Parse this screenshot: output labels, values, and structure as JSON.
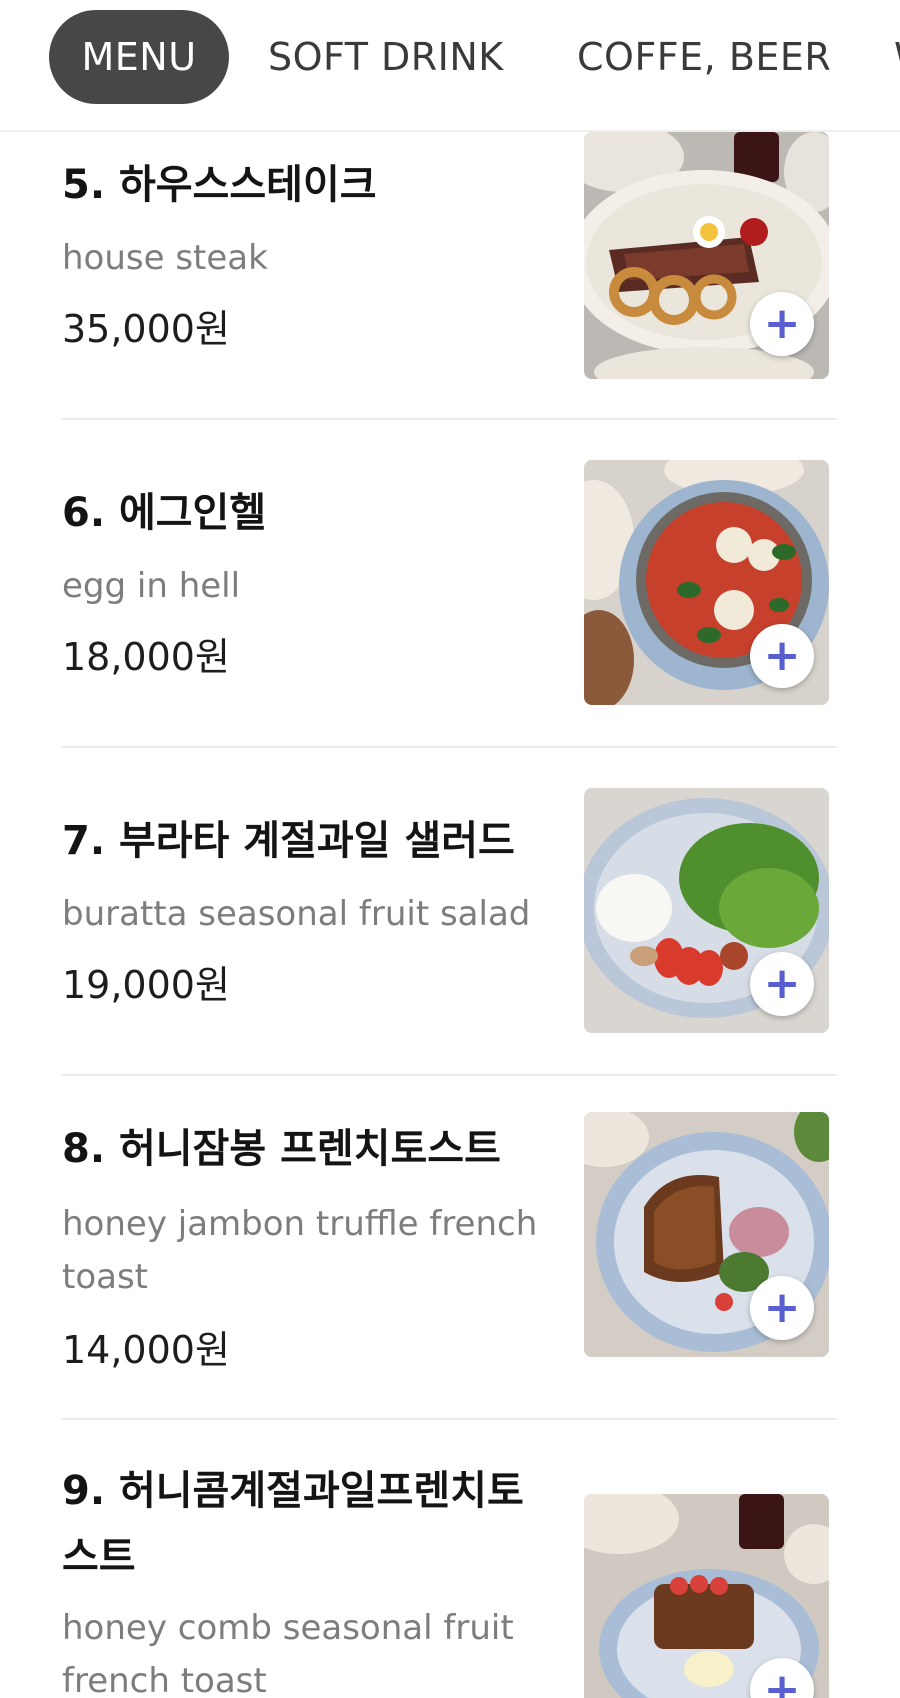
{
  "tabs": [
    {
      "label": "MENU",
      "active": true
    },
    {
      "label": "SOFT DRINK",
      "active": false
    },
    {
      "label": "COFFE, BEER",
      "active": false
    },
    {
      "label": "W",
      "active": false
    }
  ],
  "items": [
    {
      "name": "5. 하우스스테이크",
      "desc": "house steak",
      "price": "35,000원"
    },
    {
      "name": "6. 에그인헬",
      "desc": "egg in hell",
      "price": "18,000원"
    },
    {
      "name": "7. 부라타 계절과일 샐러드",
      "desc": "buratta seasonal fruit salad",
      "price": "19,000원"
    },
    {
      "name": "8. 허니잠봉 프렌치토스트",
      "desc_line1": "honey jambon truffle french",
      "desc_line2": "toast",
      "price": "14,000원"
    },
    {
      "name_line1": "9. 허니콤계절과일프렌치토",
      "name_line2": "스트",
      "desc_line1": "honey comb seasonal fruit",
      "desc_line2": "french toast"
    }
  ],
  "add_label": "+",
  "colors": {
    "tab_active_bg": "#474747",
    "add_icon": "#5a5fd0",
    "desc_text": "#7d7d7d"
  }
}
